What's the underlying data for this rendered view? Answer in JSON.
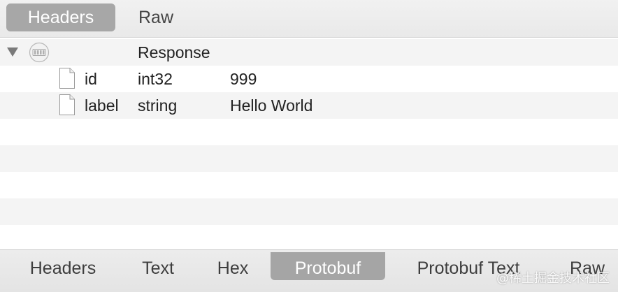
{
  "top_tabs": [
    {
      "label": "Headers",
      "active": true
    },
    {
      "label": "Raw",
      "active": false
    }
  ],
  "tree": {
    "root": {
      "name": "",
      "type": "Response",
      "value": "",
      "icon": "message-icon",
      "expanded": true
    },
    "fields": [
      {
        "name": "id",
        "type": "int32",
        "value": "999",
        "icon": "file-icon"
      },
      {
        "name": "label",
        "type": "string",
        "value": "Hello World",
        "icon": "file-icon"
      }
    ]
  },
  "bottom_tabs": [
    {
      "label": "Headers",
      "active": false
    },
    {
      "label": "Text",
      "active": false
    },
    {
      "label": "Hex",
      "active": false
    },
    {
      "label": "Protobuf",
      "active": true
    },
    {
      "label": "Protobuf Text",
      "active": false
    },
    {
      "label": "Raw",
      "active": false
    }
  ],
  "watermark": "@稀土掘金技术社区",
  "colors": {
    "active_tab_bg": "#a7a7a7",
    "active_tab_text": "#ffffff",
    "stripe": "#f4f4f4"
  }
}
